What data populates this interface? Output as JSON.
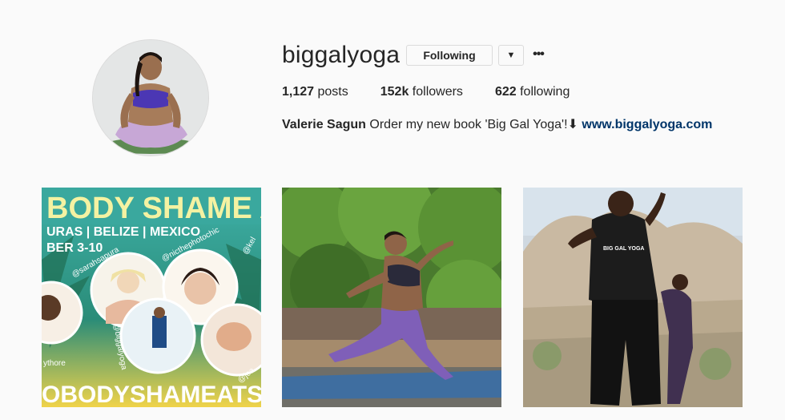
{
  "profile": {
    "username": "biggalyoga",
    "following_button": "Following",
    "dropdown_icon": "▼",
    "more_icon": "•••",
    "stats": [
      {
        "count": "1,127",
        "label": "posts"
      },
      {
        "count": "152k",
        "label": "followers"
      },
      {
        "count": "622",
        "label": "following"
      }
    ],
    "bio_name": "Valerie Sagun",
    "bio_text": "Order my new book 'Big Gal Yoga'!⬇",
    "bio_link": "www.biggalyoga.com"
  },
  "posts": [
    {
      "headline": "BODY SHAME AT S",
      "places": "URAS | BELIZE | MEXICO",
      "dates": "BER 3-10",
      "handles": [
        "@sarahsapura",
        "@nicthephotochic",
        "@biggalyoga",
        "@kel",
        "ythore",
        "@jea"
      ],
      "footer": "OBODYSHAMEATSEA.CO"
    },
    {
      "scene": "yoga-lunge-photo"
    },
    {
      "scene": "desert-photo",
      "shirt_text": "BIG GAL YOGA"
    }
  ]
}
